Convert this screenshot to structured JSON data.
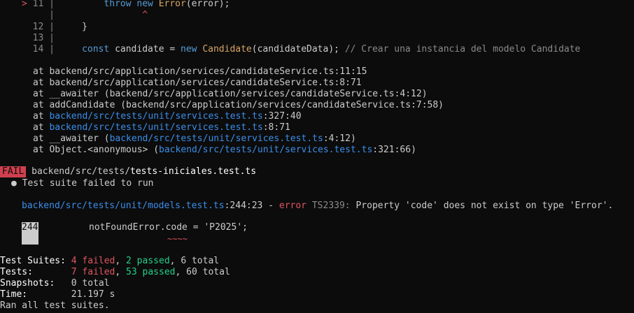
{
  "code": {
    "l11_marker": ">",
    "l11_num": "11",
    "l11_code_kw": "throw",
    "l11_code_new": "new",
    "l11_code_cls": "Error",
    "l11_code_rest": "(error);",
    "l11_caret": "^",
    "l12_num": "12",
    "l12_code": "}",
    "l13_num": "13",
    "l14_num": "14",
    "l14_kw": "const",
    "l14_var": " candidate = ",
    "l14_new": "new",
    "l14_cls": "Candidate",
    "l14_rest": "(candidateData);",
    "l14_cmt": "// Crear una instancia del modelo Candidate"
  },
  "stack": [
    {
      "prefix": "at ",
      "text": "backend/src/application/services/candidateService.ts:11:15"
    },
    {
      "prefix": "at ",
      "text": "backend/src/application/services/candidateService.ts:8:71"
    },
    {
      "prefix": "at ",
      "text": "__awaiter (backend/src/application/services/candidateService.ts:4:12)"
    },
    {
      "prefix": "at ",
      "text": "addCandidate (backend/src/application/services/candidateService.ts:7:58)"
    }
  ],
  "stack_links": [
    {
      "prefix": "at ",
      "pre": "",
      "link": "backend/src/tests/unit/services.test.ts",
      "post": ":327:40"
    },
    {
      "prefix": "at ",
      "pre": "",
      "link": "backend/src/tests/unit/services.test.ts",
      "post": ":8:71"
    },
    {
      "prefix": "at ",
      "pre": "__awaiter (",
      "link": "backend/src/tests/unit/services.test.ts",
      "post": ":4:12)"
    },
    {
      "prefix": "at ",
      "pre": "Object.<anonymous> (",
      "link": "backend/src/tests/unit/services.test.ts",
      "post": ":321:66)"
    }
  ],
  "fail": {
    "badge": "FAIL",
    "path_dir": "backend/src/tests/",
    "path_file": "tests-iniciales.test.ts",
    "bullet": "●",
    "message": "Test suite failed to run"
  },
  "ts_error": {
    "file": "backend/src/tests/unit/models.test.ts",
    "loc": ":244:23",
    "dash": " - ",
    "error_word": "error",
    "code": "TS2339:",
    "message": " Property 'code' does not exist on type 'Error'."
  },
  "snippet": {
    "line_num": "244",
    "code": "notFoundError.code = 'P2025';",
    "squiggle": "~~~~"
  },
  "summary": {
    "suites_label": "Test Suites:",
    "suites_failed": "4 failed",
    "suites_passed": "2 passed",
    "suites_total": "6 total",
    "tests_label": "Tests:",
    "tests_failed": "7 failed",
    "tests_passed": "53 passed",
    "tests_total": "60 total",
    "snap_label": "Snapshots:",
    "snap_value": "0 total",
    "time_label": "Time:",
    "time_value": "21.197 s",
    "ran": "Ran all test suites."
  }
}
